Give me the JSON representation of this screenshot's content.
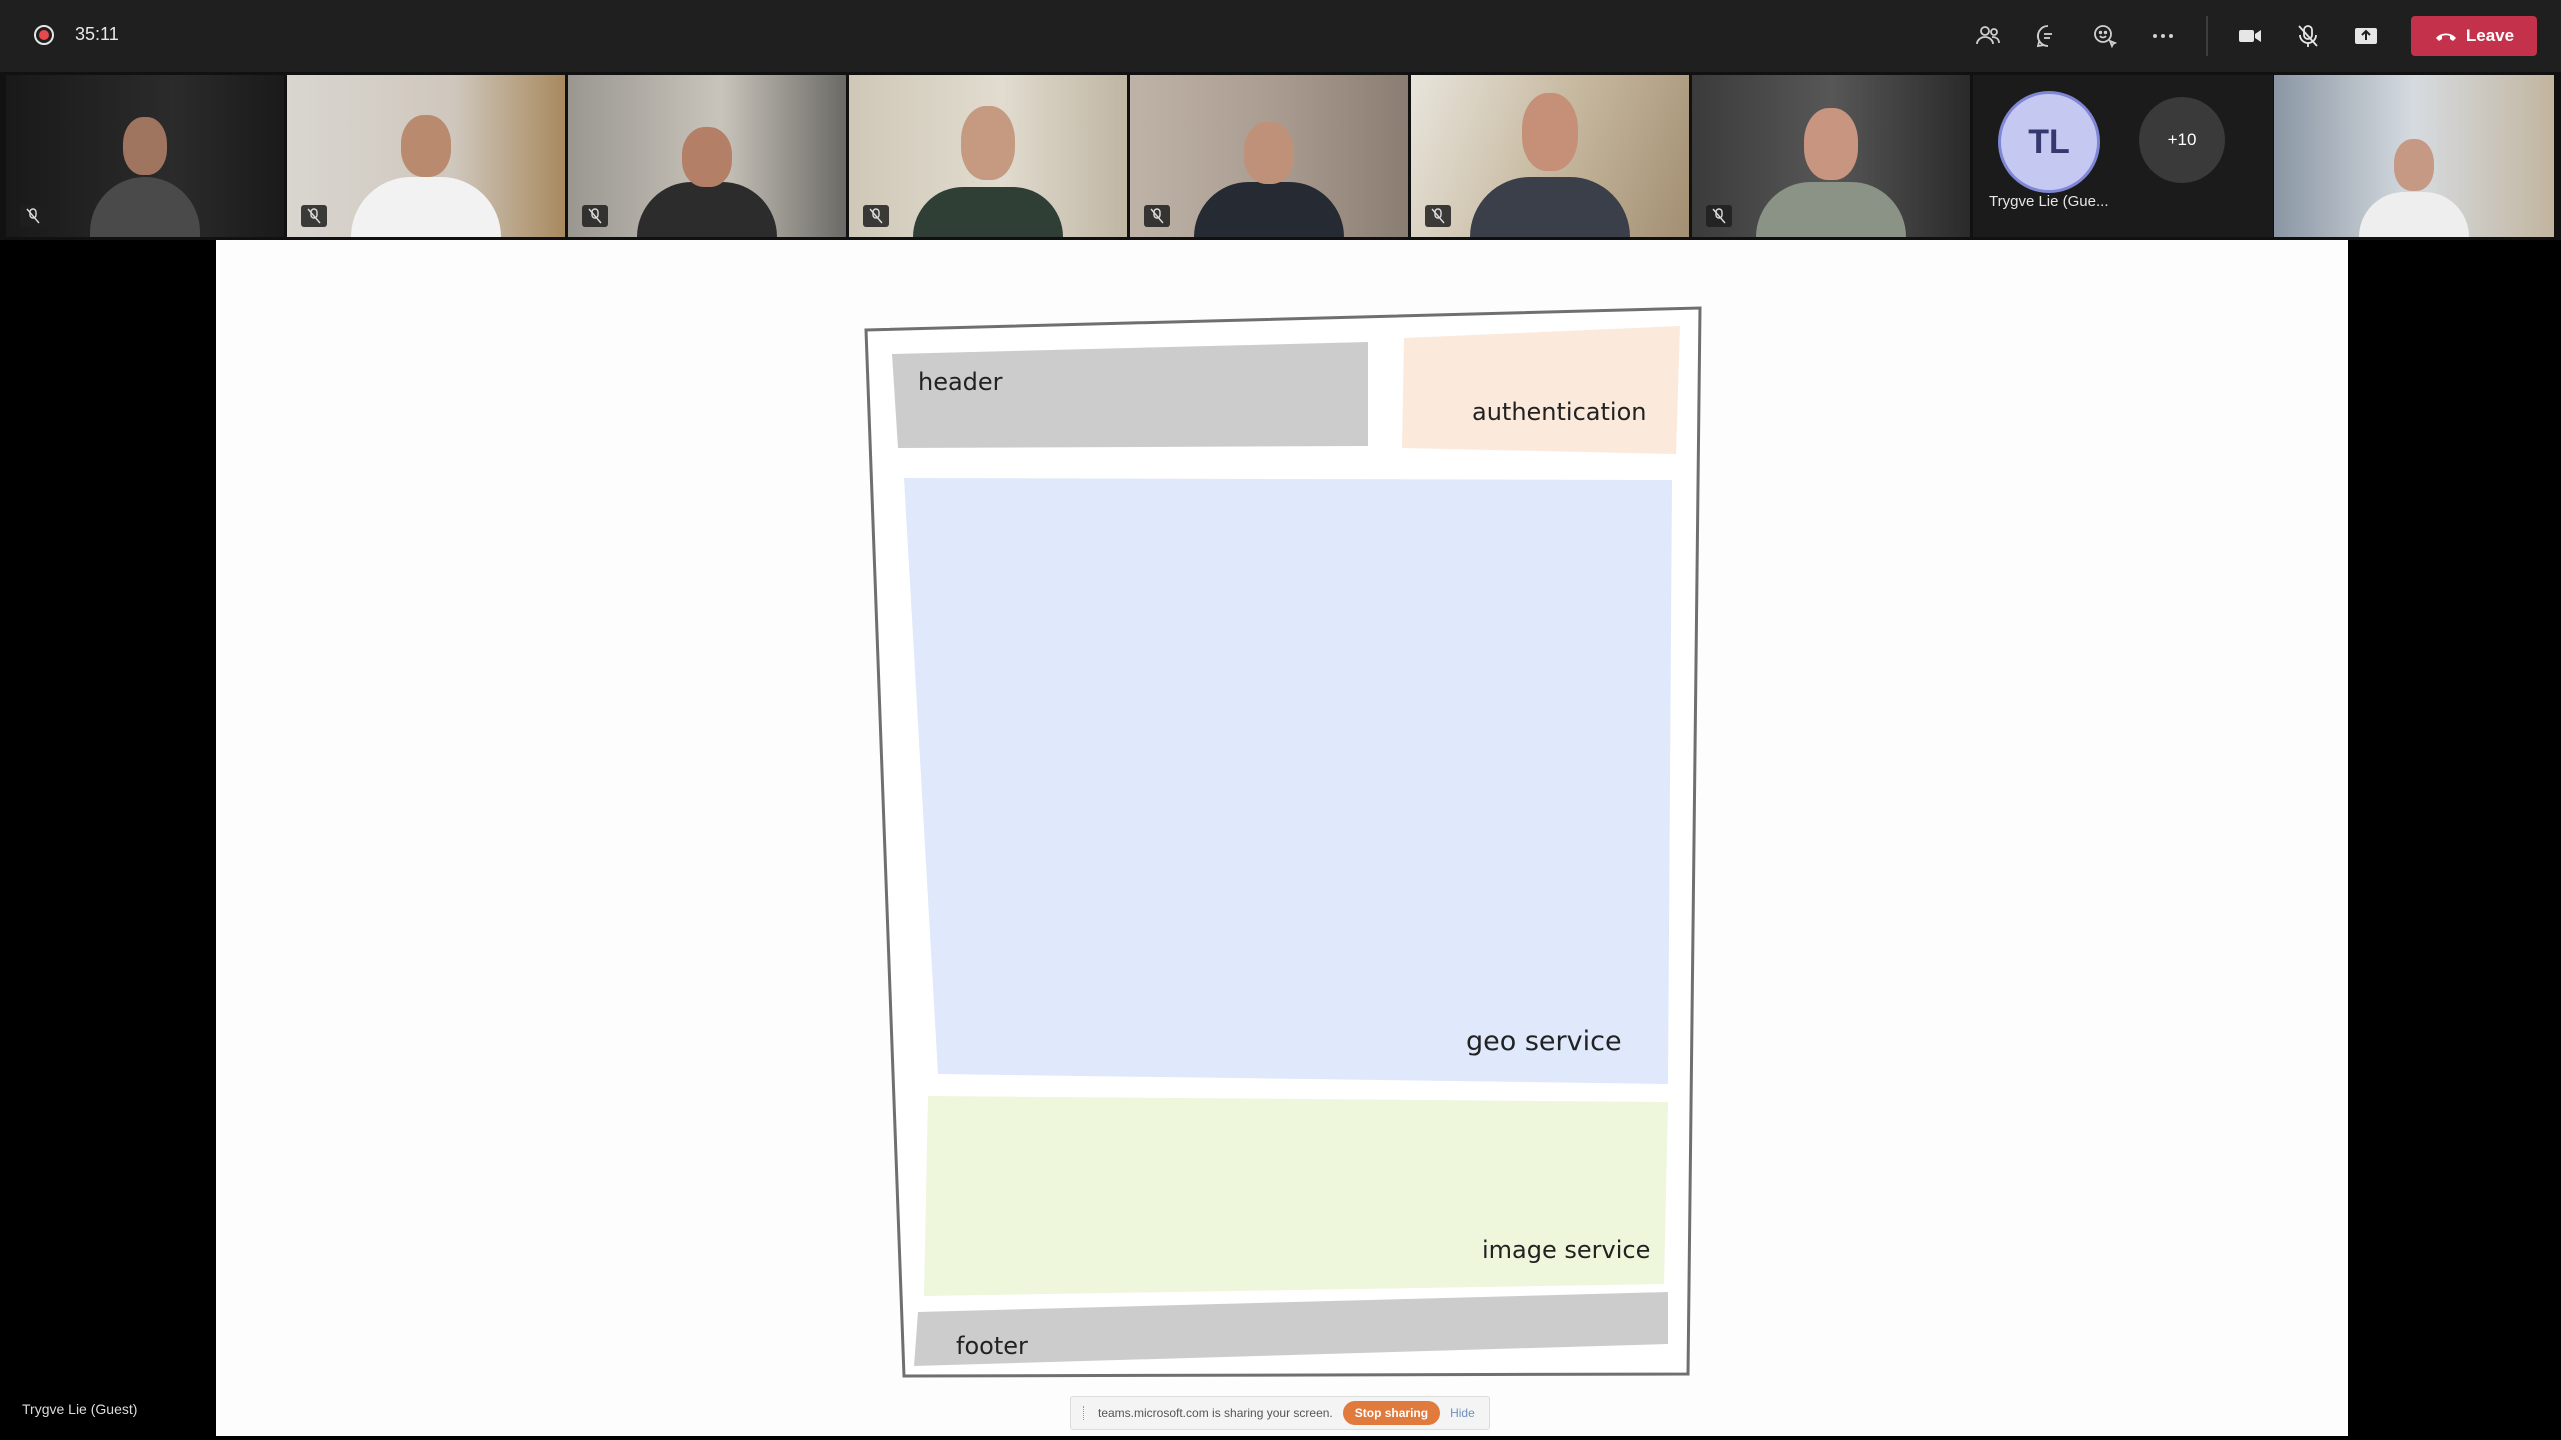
{
  "topbar": {
    "timer": "35:11",
    "leave_label": "Leave",
    "icons": [
      "people-icon",
      "chat-icon",
      "reactions-icon",
      "more-icon",
      "camera-icon",
      "mic-off-icon",
      "share-icon",
      "hangup-icon"
    ]
  },
  "participants": {
    "avatar_initials": "TL",
    "avatar_name": "Trygve Lie (Gue...",
    "overflow_count": "+10"
  },
  "slide": {
    "labels": {
      "header": "header",
      "authentication": "authentication",
      "geo": "geo service",
      "image": "image service",
      "footer": "footer"
    },
    "colors": {
      "header": "#cccccc",
      "authentication": "#fbeadb",
      "geo": "#dfe9fb",
      "image": "#eef6dc",
      "footer": "#cccccc"
    }
  },
  "presenter_name": "Trygve Lie (Guest)",
  "sharebar": {
    "text": "teams.microsoft.com is sharing your screen.",
    "stop_label": "Stop sharing",
    "hide_label": "Hide"
  }
}
